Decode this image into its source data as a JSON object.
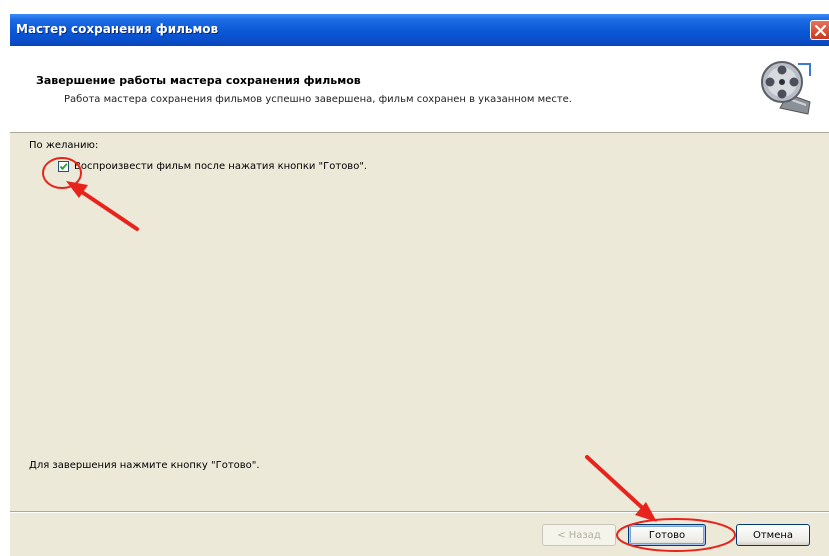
{
  "window": {
    "title": "Мастер сохранения фильмов"
  },
  "header": {
    "title": "Завершение работы мастера сохранения фильмов",
    "subtitle": "Работа мастера сохранения фильмов успешно завершена, фильм сохранен в указанном месте.",
    "icon": "film-reel-icon"
  },
  "content": {
    "optional_label": "По желанию:",
    "play_checkbox": {
      "label": "Воспроизвести фильм после нажатия кнопки \"Готово\".",
      "checked": true
    },
    "finish_hint": "Для завершения нажмите кнопку \"Готово\"."
  },
  "buttons": {
    "back_label": "< Назад",
    "finish_label": "Готово",
    "cancel_label": "Отмена"
  },
  "annotations": {
    "color": "#e8231b"
  }
}
